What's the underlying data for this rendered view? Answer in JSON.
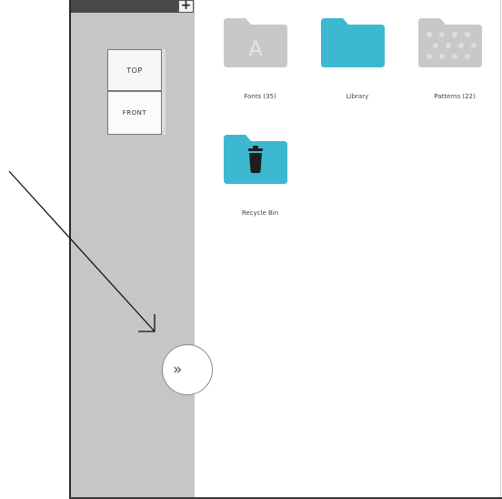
{
  "toolbar": {
    "add_label": "+"
  },
  "view_cube": {
    "top_label": "TOP",
    "front_label": "FRONT"
  },
  "panel": {
    "expand_label": "»"
  },
  "files": [
    {
      "label": "Fonts (35)",
      "icon": "fonts-folder-icon",
      "color": "#c8c8c8",
      "glyph": "A"
    },
    {
      "label": "Library",
      "icon": "library-folder-icon",
      "color": "#3cb8d0"
    },
    {
      "label": "Patterns (22)",
      "icon": "patterns-folder-icon",
      "color": "#c8c8c8"
    },
    {
      "label": "Recycle Bin",
      "icon": "recycle-bin-icon",
      "color": "#3cb8d0"
    }
  ],
  "colors": {
    "panel_bg": "#c6c6c6",
    "accent": "#3cb8d0"
  }
}
